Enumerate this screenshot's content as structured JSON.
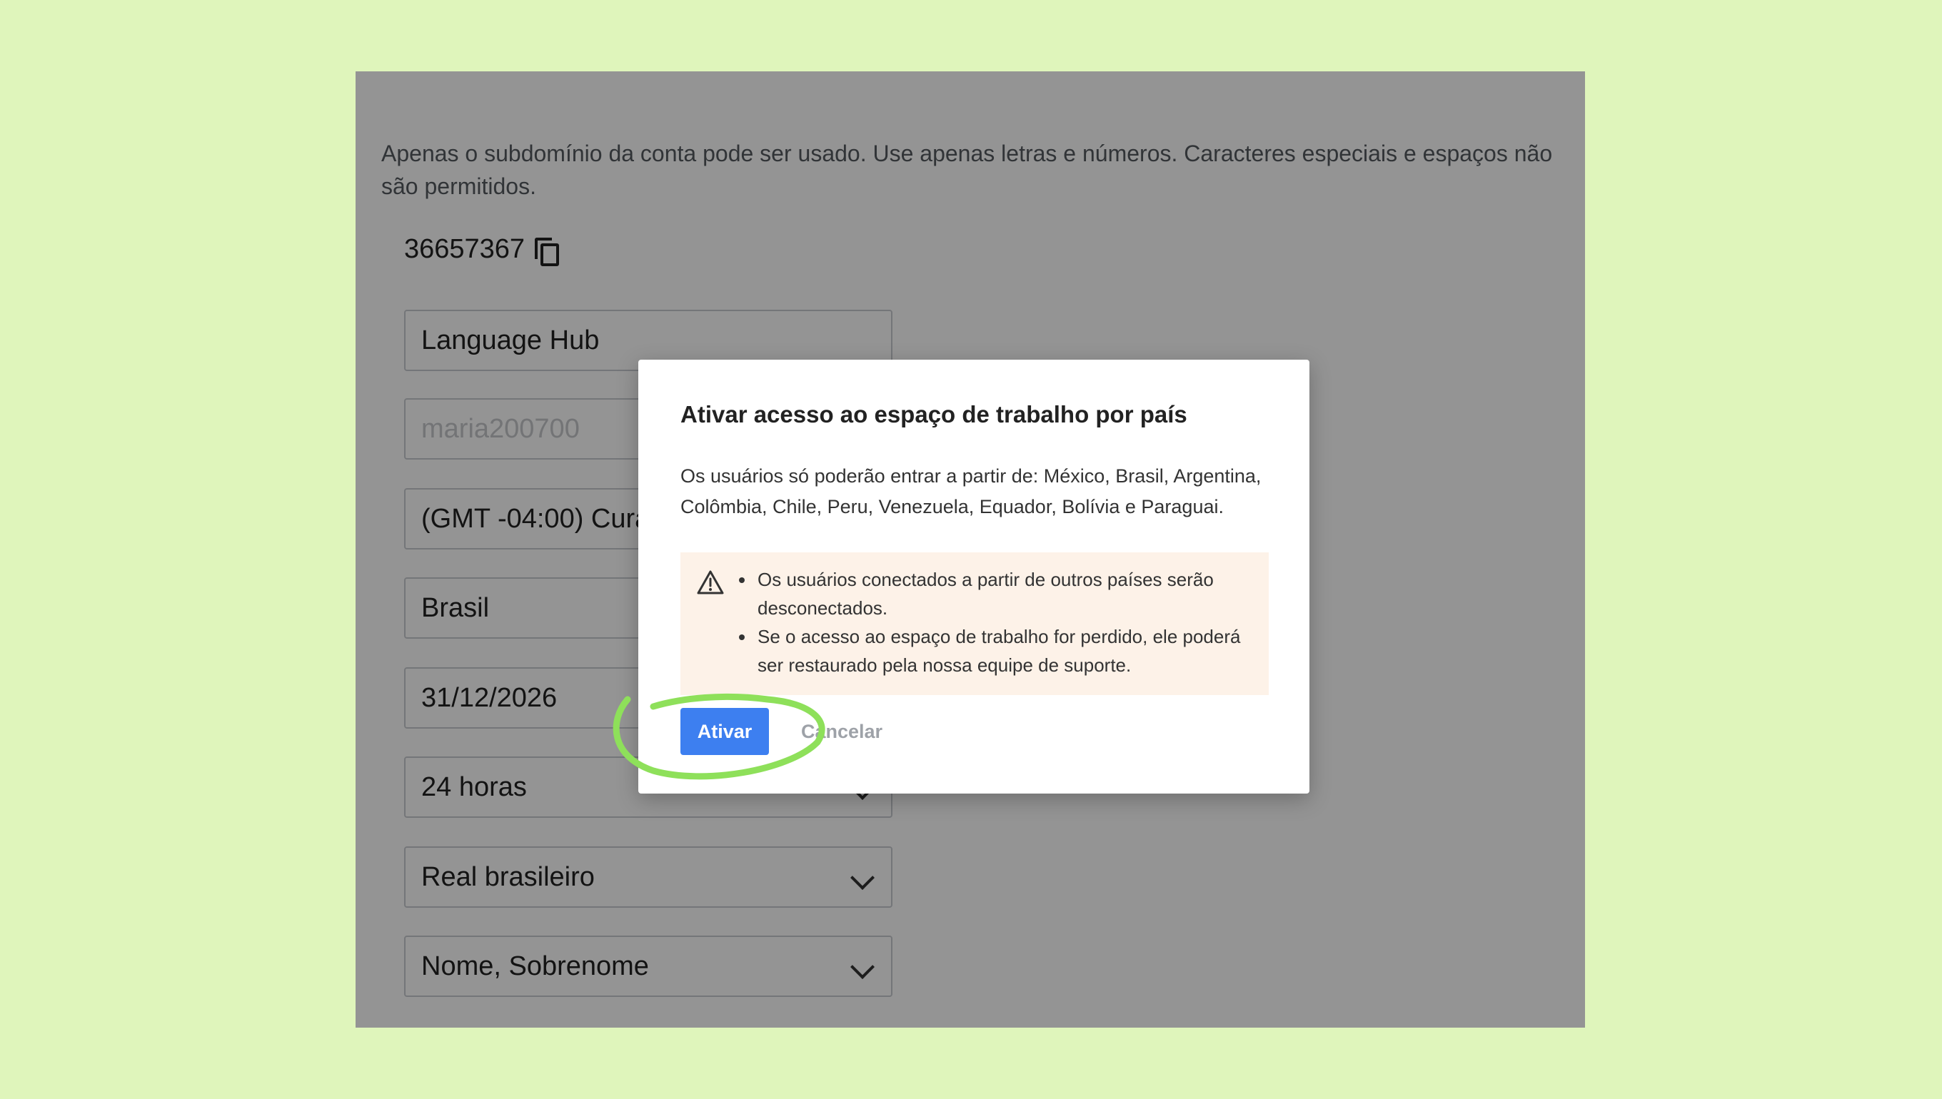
{
  "page": {
    "help_text": "Apenas o subdomínio da conta pode ser usado. Use apenas letras e números. Caracteres especiais e espaços não são permitidos.",
    "account_id": "36657367",
    "fields": {
      "company_name": "Language Hub",
      "login_placeholder": "maria200700",
      "timezone": "(GMT -04:00) Curaca",
      "country": "Brasil",
      "date": "31/12/2026",
      "time_format": "24 horas",
      "currency": "Real brasileiro",
      "name_format": "Nome, Sobrenome"
    }
  },
  "modal": {
    "title": "Ativar acesso ao espaço de trabalho por país",
    "body": "Os usuários só poderão entrar a partir de: México, Brasil, Argentina, Colômbia, Chile, Peru, Venezuela, Equador, Bolívia e Paraguai.",
    "warnings": [
      "Os usuários conectados a partir de outros países serão desconectados.",
      "Se o acesso ao espaço de trabalho for perdido, ele poderá ser restaurado pela nossa equipe de suporte."
    ],
    "confirm_label": "Ativar",
    "cancel_label": "Cancelar"
  },
  "colors": {
    "background": "#dff5bb",
    "primary": "#3d7ff0",
    "highlight": "#8ee05a",
    "warning_bg": "#fdf2e8"
  },
  "icons": [
    "copy-icon",
    "warning-icon",
    "chevron-down-icon"
  ]
}
